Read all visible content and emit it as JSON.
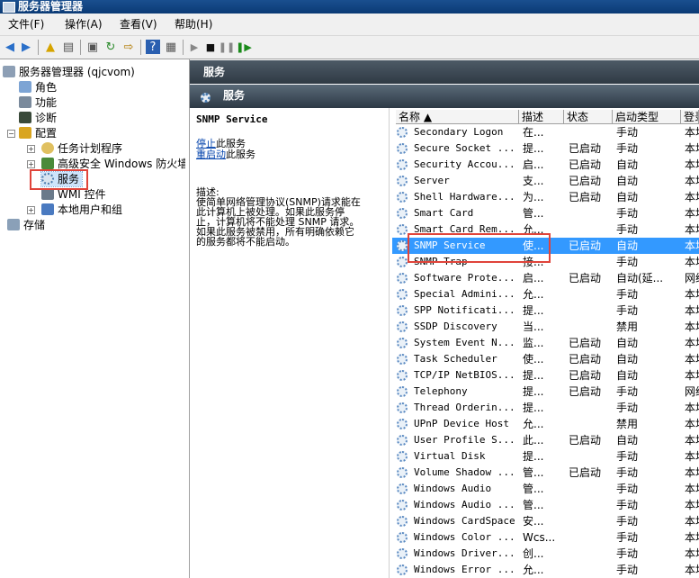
{
  "window": {
    "title": "服务器管理器"
  },
  "menu": [
    "文件(F)",
    "操作(A)",
    "查看(V)",
    "帮助(H)"
  ],
  "tree": {
    "root": "服务器管理器 (qjcvom)",
    "roles": "角色",
    "features": "功能",
    "diagnostics": "诊断",
    "config": "配置",
    "task_scheduler": "任务计划程序",
    "firewall": "高级安全 Windows 防火墙",
    "services": "服务",
    "wmi": "WMI 控件",
    "local_users": "本地用户和组",
    "storage": "存储"
  },
  "header": {
    "panel_title": "服务",
    "section_title": "服务"
  },
  "detail": {
    "service_name": "SNMP Service",
    "stop_link": "停止",
    "stop_suffix": "此服务",
    "restart_link": "重启动",
    "restart_suffix": "此服务",
    "desc_label": "描述:",
    "desc_lines": [
      "使简单网络管理协议(SNMP)请求能在",
      "此计算机上被处理。如果此服务停",
      "止，计算机将不能处理 SNMP 请求。",
      "如果此服务被禁用，所有明确依赖它",
      "的服务都将不能启动。"
    ]
  },
  "columns": [
    "名称 ▲",
    "描述",
    "状态",
    "启动类型",
    "登录为"
  ],
  "services": [
    {
      "name": "Secondary Logon",
      "desc": "在...",
      "status": "",
      "startup": "手动",
      "logon": "本地系统"
    },
    {
      "name": "Secure Socket ...",
      "desc": "提...",
      "status": "已启动",
      "startup": "手动",
      "logon": "本地服务"
    },
    {
      "name": "Security Accou...",
      "desc": "启...",
      "status": "已启动",
      "startup": "自动",
      "logon": "本地系统"
    },
    {
      "name": "Server",
      "desc": "支...",
      "status": "已启动",
      "startup": "自动",
      "logon": "本地系统"
    },
    {
      "name": "Shell Hardware...",
      "desc": "为...",
      "status": "已启动",
      "startup": "自动",
      "logon": "本地系统"
    },
    {
      "name": "Smart Card",
      "desc": "管...",
      "status": "",
      "startup": "手动",
      "logon": "本地服务"
    },
    {
      "name": "Smart Card Rem...",
      "desc": "允...",
      "status": "",
      "startup": "手动",
      "logon": "本地系统"
    },
    {
      "name": "SNMP Service",
      "desc": "使...",
      "status": "已启动",
      "startup": "自动",
      "logon": "本地系统"
    },
    {
      "name": "SNMP Trap",
      "desc": "接...",
      "status": "",
      "startup": "手动",
      "logon": "本地服务"
    },
    {
      "name": "Software Prote...",
      "desc": "启...",
      "status": "已启动",
      "startup": "自动(延...",
      "logon": "网络服务"
    },
    {
      "name": "Special Admini...",
      "desc": "允...",
      "status": "",
      "startup": "手动",
      "logon": "本地系统"
    },
    {
      "name": "SPP Notificati...",
      "desc": "提...",
      "status": "",
      "startup": "手动",
      "logon": "本地服务"
    },
    {
      "name": "SSDP Discovery",
      "desc": "当...",
      "status": "",
      "startup": "禁用",
      "logon": "本地服务"
    },
    {
      "name": "System Event N...",
      "desc": "监...",
      "status": "已启动",
      "startup": "自动",
      "logon": "本地系统"
    },
    {
      "name": "Task Scheduler",
      "desc": "使...",
      "status": "已启动",
      "startup": "自动",
      "logon": "本地系统"
    },
    {
      "name": "TCP/IP NetBIOS...",
      "desc": "提...",
      "status": "已启动",
      "startup": "自动",
      "logon": "本地服务"
    },
    {
      "name": "Telephony",
      "desc": "提...",
      "status": "已启动",
      "startup": "手动",
      "logon": "网络服务"
    },
    {
      "name": "Thread Orderin...",
      "desc": "提...",
      "status": "",
      "startup": "手动",
      "logon": "本地服务"
    },
    {
      "name": "UPnP Device Host",
      "desc": "允...",
      "status": "",
      "startup": "禁用",
      "logon": "本地服务"
    },
    {
      "name": "User Profile S...",
      "desc": "此...",
      "status": "已启动",
      "startup": "自动",
      "logon": "本地系统"
    },
    {
      "name": "Virtual Disk",
      "desc": "提...",
      "status": "",
      "startup": "手动",
      "logon": "本地系统"
    },
    {
      "name": "Volume Shadow ...",
      "desc": "管...",
      "status": "已启动",
      "startup": "手动",
      "logon": "本地系统"
    },
    {
      "name": "Windows Audio",
      "desc": "管...",
      "status": "",
      "startup": "手动",
      "logon": "本地服务"
    },
    {
      "name": "Windows Audio ...",
      "desc": "管...",
      "status": "",
      "startup": "手动",
      "logon": "本地系统"
    },
    {
      "name": "Windows CardSpace",
      "desc": "安...",
      "status": "",
      "startup": "手动",
      "logon": "本地系统"
    },
    {
      "name": "Windows Color ...",
      "desc": "Wcs...",
      "status": "",
      "startup": "手动",
      "logon": "本地服务"
    },
    {
      "name": "Windows Driver...",
      "desc": "创...",
      "status": "",
      "startup": "手动",
      "logon": "本地系统"
    },
    {
      "name": "Windows Error ...",
      "desc": "允...",
      "status": "",
      "startup": "手动",
      "logon": "本地系统"
    }
  ],
  "selected_index": 7
}
